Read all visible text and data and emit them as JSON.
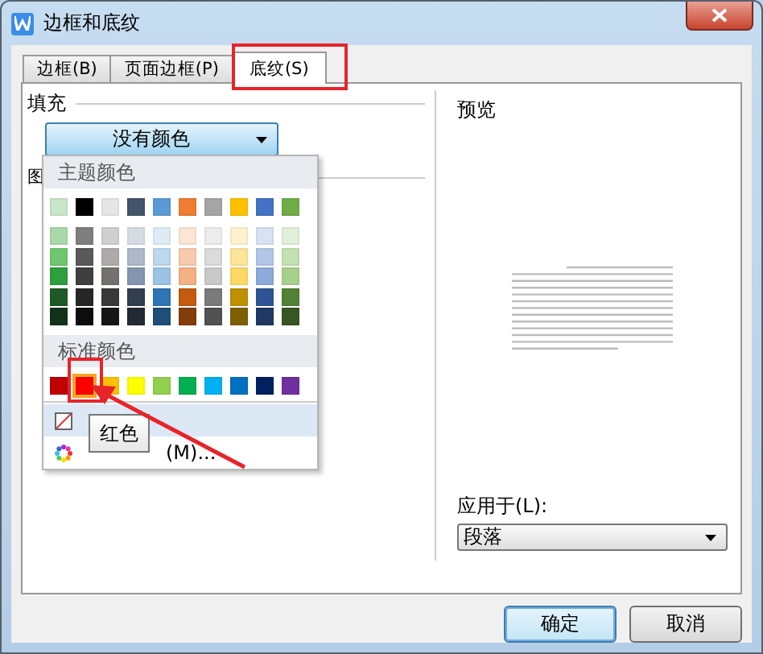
{
  "window": {
    "title": "边框和底纹"
  },
  "tabs": [
    {
      "label": "边框(B)",
      "selected": false
    },
    {
      "label": "页面边框(P)",
      "selected": false
    },
    {
      "label": "底纹(S)",
      "selected": true
    }
  ],
  "fill": {
    "label": "填充",
    "dropdown": "没有颜色"
  },
  "pattern": {
    "label": "图"
  },
  "color_menu": {
    "theme_header": "主题颜色",
    "theme_colors": [
      {
        "color": "#c8e6c9"
      },
      {
        "color": "#000000"
      },
      {
        "color": "#e7e6e6"
      },
      {
        "color": "#44546a"
      },
      {
        "color": "#5b9bd5"
      },
      {
        "color": "#ed7d31"
      },
      {
        "color": "#a5a5a5"
      },
      {
        "color": "#ffc000"
      },
      {
        "color": "#4472c4"
      },
      {
        "color": "#70ad47"
      }
    ],
    "shade_rows": [
      [
        {
          "color": "#a9d9a9"
        },
        {
          "color": "#7f7f7f"
        },
        {
          "color": "#d0cece"
        },
        {
          "color": "#d6dce4"
        },
        {
          "color": "#deebf6"
        },
        {
          "color": "#fbe5d5"
        },
        {
          "color": "#ededed"
        },
        {
          "color": "#fff2cc"
        },
        {
          "color": "#d9e2f3"
        },
        {
          "color": "#e2efd9"
        }
      ],
      [
        {
          "color": "#70c670"
        },
        {
          "color": "#595959"
        },
        {
          "color": "#aeaaaa"
        },
        {
          "color": "#adb9ca"
        },
        {
          "color": "#bdd7ee"
        },
        {
          "color": "#f7cbac"
        },
        {
          "color": "#dbdbdb"
        },
        {
          "color": "#fee599"
        },
        {
          "color": "#b4c6e7"
        },
        {
          "color": "#c5e0b3"
        }
      ],
      [
        {
          "color": "#2e9e3f"
        },
        {
          "color": "#3f3f3f"
        },
        {
          "color": "#757070"
        },
        {
          "color": "#8496b0"
        },
        {
          "color": "#9cc3e5"
        },
        {
          "color": "#f4b183"
        },
        {
          "color": "#c9c9c9"
        },
        {
          "color": "#ffd965"
        },
        {
          "color": "#8eaadb"
        },
        {
          "color": "#a8d08d"
        }
      ],
      [
        {
          "color": "#1e5a28"
        },
        {
          "color": "#262626"
        },
        {
          "color": "#3a3838"
        },
        {
          "color": "#323f4f"
        },
        {
          "color": "#2e75b5"
        },
        {
          "color": "#c55a11"
        },
        {
          "color": "#7b7b7b"
        },
        {
          "color": "#bf9000"
        },
        {
          "color": "#2f5496"
        },
        {
          "color": "#538135"
        }
      ],
      [
        {
          "color": "#13321a"
        },
        {
          "color": "#0d0d0d"
        },
        {
          "color": "#171616"
        },
        {
          "color": "#222a35"
        },
        {
          "color": "#1e4e79"
        },
        {
          "color": "#843c0b"
        },
        {
          "color": "#525252"
        },
        {
          "color": "#7f6000"
        },
        {
          "color": "#1f3864"
        },
        {
          "color": "#375623"
        }
      ]
    ],
    "standard_header": "标准颜色",
    "standard_colors": [
      {
        "color": "#c00000",
        "selected": false
      },
      {
        "color": "#ff0000",
        "selected": true
      },
      {
        "color": "#ffc000",
        "selected": false
      },
      {
        "color": "#ffff00",
        "selected": false
      },
      {
        "color": "#92d050",
        "selected": false
      },
      {
        "color": "#00b050",
        "selected": false
      },
      {
        "color": "#00b0f0",
        "selected": false
      },
      {
        "color": "#0070c0",
        "selected": false
      },
      {
        "color": "#002060",
        "selected": false
      },
      {
        "color": "#7030a0",
        "selected": false
      }
    ],
    "more_colors": "(M)...",
    "tooltip": "红色"
  },
  "preview": {
    "label": "预览"
  },
  "apply_to": {
    "label": "应用于(L):",
    "value": "段落"
  },
  "buttons": [
    {
      "label": "确定",
      "kind": "default"
    },
    {
      "label": "取消",
      "kind": "normal"
    }
  ]
}
